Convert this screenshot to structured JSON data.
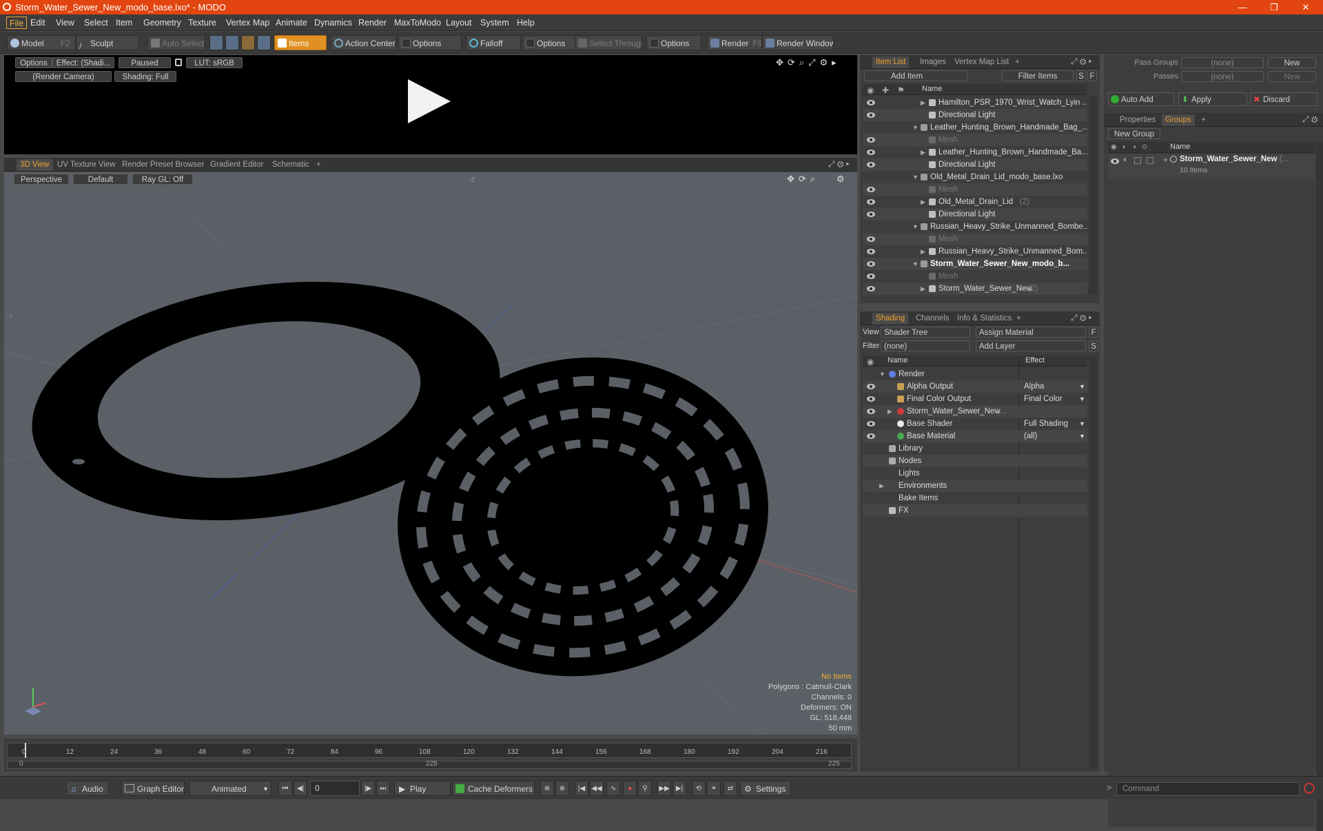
{
  "window": {
    "title": "Storm_Water_Sewer_New_modo_base.lxo* - MODO",
    "minimize": "—",
    "maximize": "❐",
    "close": "✕"
  },
  "menu": [
    "File",
    "Edit",
    "View",
    "Select",
    "Item",
    "Geometry",
    "Texture",
    "Vertex Map",
    "Animate",
    "Dynamics",
    "Render",
    "MaxToModo",
    "Layout",
    "System",
    "Help"
  ],
  "toolbar": {
    "model": "Model",
    "model_key": "F2",
    "sculpt": "Sculpt",
    "auto_select": "Auto Select",
    "items": "Items",
    "action_center": "Action Center",
    "options1": "Options",
    "falloff": "Falloff",
    "options2": "Options",
    "select_through": "Select Through",
    "options3": "Options",
    "render": "Render",
    "render_key": "F9",
    "render_window": "Render Window"
  },
  "preview": {
    "options": "Options",
    "effect": "Effect: (Shadi...",
    "paused": "Paused",
    "lut": "LUT: sRGB",
    "camera": "(Render Camera)",
    "shading": "Shading: Full"
  },
  "viewport_tabs": [
    "3D View",
    "UV Texture View",
    "Render Preset Browser",
    "Gradient Editor",
    "Schematic",
    "+"
  ],
  "viewport": {
    "perspective": "Perspective",
    "default": "Default",
    "raygl": "Ray GL: Off",
    "axis_label": "-Z",
    "axis_left": "-X",
    "status_title": "No Items",
    "status_lines": [
      "Polygons : Catmull-Clark",
      "Channels: 0",
      "Deformers: ON",
      "GL: 518,448",
      "50 mm"
    ]
  },
  "timeline": {
    "ticks": [
      "0",
      "12",
      "24",
      "36",
      "48",
      "60",
      "72",
      "84",
      "96",
      "108",
      "120",
      "132",
      "144",
      "156",
      "168",
      "180",
      "192",
      "204",
      "216"
    ],
    "sub_start": "0",
    "sub_mid": "225",
    "sub_end": "225"
  },
  "item_list": {
    "tabs": [
      "Item List",
      "Images",
      "Vertex Map List",
      "+"
    ],
    "add_item": "Add Item",
    "filter_items": "Filter Items",
    "s_btn": "S",
    "f_btn": "F",
    "col_name": "Name",
    "rows": [
      {
        "indent": 2,
        "label": "Hamilton_PSR_1970_Wrist_Watch_Lyin ...",
        "dim": false,
        "bold": false,
        "arrow": "▶",
        "eye": true
      },
      {
        "indent": 2,
        "label": "Directional Light",
        "dim": false,
        "bold": false,
        "arrow": "",
        "eye": true
      },
      {
        "indent": 1,
        "label": "Leather_Hunting_Brown_Handmade_Bag_...",
        "dim": false,
        "bold": false,
        "arrow": "▼",
        "eye": false
      },
      {
        "indent": 2,
        "label": "Mesh",
        "dim": true,
        "bold": false,
        "arrow": "",
        "eye": true
      },
      {
        "indent": 2,
        "label": "Leather_Hunting_Brown_Handmade_Ba...",
        "dim": false,
        "bold": false,
        "arrow": "▶",
        "eye": true
      },
      {
        "indent": 2,
        "label": "Directional Light",
        "dim": false,
        "bold": false,
        "arrow": "",
        "eye": true
      },
      {
        "indent": 1,
        "label": "Old_Metal_Drain_Lid_modo_base.lxo",
        "dim": false,
        "bold": false,
        "arrow": "▼",
        "eye": false
      },
      {
        "indent": 2,
        "label": "Mesh",
        "dim": true,
        "bold": false,
        "arrow": "",
        "eye": true
      },
      {
        "indent": 2,
        "label": "Old_Metal_Drain_Lid",
        "suffix": " (2)",
        "dim": false,
        "bold": false,
        "arrow": "▶",
        "eye": true
      },
      {
        "indent": 2,
        "label": "Directional Light",
        "dim": false,
        "bold": false,
        "arrow": "",
        "eye": true
      },
      {
        "indent": 1,
        "label": "Russian_Heavy_Strike_Unmanned_Bombe...",
        "dim": false,
        "bold": false,
        "arrow": "▼",
        "eye": false
      },
      {
        "indent": 2,
        "label": "Mesh",
        "dim": true,
        "bold": false,
        "arrow": "",
        "eye": true
      },
      {
        "indent": 2,
        "label": "Russian_Heavy_Strike_Unmanned_Bom...",
        "dim": false,
        "bold": false,
        "arrow": "▶",
        "eye": true
      },
      {
        "indent": 1,
        "label": "Storm_Water_Sewer_New_modo_b...",
        "dim": false,
        "bold": true,
        "arrow": "▼",
        "eye": true
      },
      {
        "indent": 2,
        "label": "Mesh",
        "dim": true,
        "bold": false,
        "arrow": "",
        "eye": true
      },
      {
        "indent": 2,
        "label": "Storm_Water_Sewer_New",
        "suffix": " (2)",
        "dim": false,
        "bold": false,
        "arrow": "▶",
        "eye": true
      }
    ]
  },
  "shading": {
    "tabs": [
      "Shading",
      "Channels",
      "Info & Statistics",
      "+"
    ],
    "view_label": "View",
    "view_value": "Shader Tree",
    "assign_material": "Assign Material",
    "f_btn": "F",
    "filter_label": "Filter",
    "filter_value": "(none)",
    "add_layer": "Add Layer",
    "s_btn": "S",
    "col_name": "Name",
    "col_effect": "Effect",
    "rows": [
      {
        "indent": 0,
        "label": "Render",
        "effect": "",
        "eye": false,
        "arrow": "▼",
        "icon": "sphere-blue"
      },
      {
        "indent": 1,
        "label": "Alpha Output",
        "effect": "Alpha",
        "eye": true,
        "arrow": "",
        "icon": "output"
      },
      {
        "indent": 1,
        "label": "Final Color Output",
        "effect": "Final Color",
        "eye": true,
        "arrow": "",
        "icon": "output"
      },
      {
        "indent": 1,
        "label": "Storm_Water_Sewer_New",
        "suffix": " (...",
        "effect": "",
        "eye": true,
        "arrow": "▶",
        "icon": "material-red"
      },
      {
        "indent": 1,
        "label": "Base Shader",
        "effect": "Full Shading",
        "eye": true,
        "arrow": "",
        "icon": "sphere-white"
      },
      {
        "indent": 1,
        "label": "Base Material",
        "effect": "(all)",
        "eye": true,
        "arrow": "",
        "icon": "sphere-green"
      },
      {
        "indent": 0,
        "label": "Library",
        "effect": "",
        "eye": false,
        "arrow": "",
        "icon": "folder"
      },
      {
        "indent": 0,
        "label": "Nodes",
        "effect": "",
        "eye": false,
        "arrow": "",
        "icon": "folder"
      },
      {
        "indent": 0,
        "label": "Lights",
        "effect": "",
        "eye": false,
        "arrow": "",
        "icon": ""
      },
      {
        "indent": 0,
        "label": "Environments",
        "effect": "",
        "eye": false,
        "arrow": "▶",
        "icon": ""
      },
      {
        "indent": 0,
        "label": "Bake Items",
        "effect": "",
        "eye": false,
        "arrow": "",
        "icon": ""
      },
      {
        "indent": 0,
        "label": "FX",
        "effect": "",
        "eye": false,
        "arrow": "",
        "icon": "fx"
      }
    ]
  },
  "right_panel": {
    "pass_groups": "Pass Groups",
    "passes": "Passes",
    "none1": "(none)",
    "none2": "(none)",
    "new1": "New",
    "new2": "New",
    "auto_add": "Auto Add",
    "apply": "Apply",
    "discard": "Discard",
    "tabs": [
      "Properties",
      "Groups",
      "+"
    ],
    "new_group": "New Group",
    "col_name": "Name",
    "group_name": "Storm_Water_Sewer_New",
    "group_suffix": " (...",
    "group_count": "10 Items"
  },
  "bottom": {
    "audio": "Audio",
    "graph_editor": "Graph Editor",
    "animated": "Animated",
    "frame": "0",
    "play": "Play",
    "cache_deformers": "Cache Deformers",
    "settings": "Settings",
    "command": "Command"
  },
  "colors": {
    "accent": "#e2450f",
    "orange": "#f0a030"
  }
}
